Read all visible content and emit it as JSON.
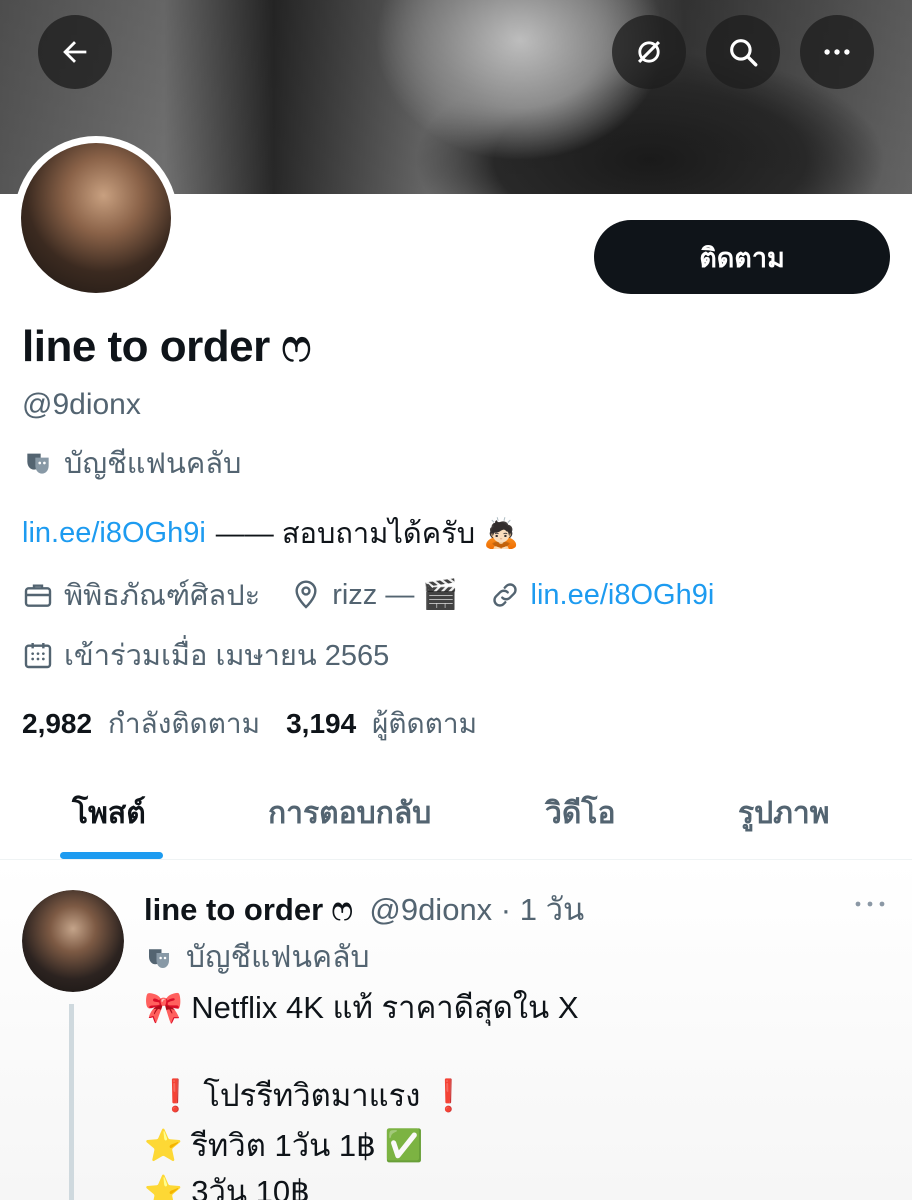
{
  "header": {
    "back_icon": "arrow-left-icon",
    "grok_icon": "grok-icon",
    "search_icon": "search-icon",
    "more_icon": "more-horizontal-icon"
  },
  "profile": {
    "follow_label": "ติดตาม",
    "display_name": "line to order ෆ",
    "handle": "@9dionx",
    "account_label": "บัญชีแฟนคลับ",
    "bio_link": "lin.ee/i8OGh9i",
    "bio_text": "—— สอบถามได้ครับ 🙇🏻",
    "category": "พิพิธภัณฑ์ศิลปะ",
    "location": "rizz — 🎬",
    "website": "lin.ee/i8OGh9i",
    "joined": "เข้าร่วมเมื่อ เมษายน 2565",
    "following_count": "2,982",
    "following_label": "กำลังติดตาม",
    "followers_count": "3,194",
    "followers_label": "ผู้ติดตาม"
  },
  "tabs": [
    {
      "label": "โพสต์",
      "active": true
    },
    {
      "label": "การตอบกลับ",
      "active": false
    },
    {
      "label": "วิดีโอ",
      "active": false
    },
    {
      "label": "รูปภาพ",
      "active": false
    }
  ],
  "post": {
    "name": "line to order ෆ",
    "handle_time": "@9dionx · 1 วัน",
    "account_label": "บัญชีแฟนคลับ",
    "line1": "🎀 Netflix 4K แท้ ราคาดีสุดใน X",
    "line2": "❗ โปรรีทวิตมาแรง ❗",
    "line3": "⭐ รีทวิต 1วัน 1฿ ✅",
    "line4": "⭐ 3วัน 10฿"
  },
  "colors": {
    "accent": "#1d9bf0",
    "text": "#0f1419",
    "secondary": "#536471"
  }
}
